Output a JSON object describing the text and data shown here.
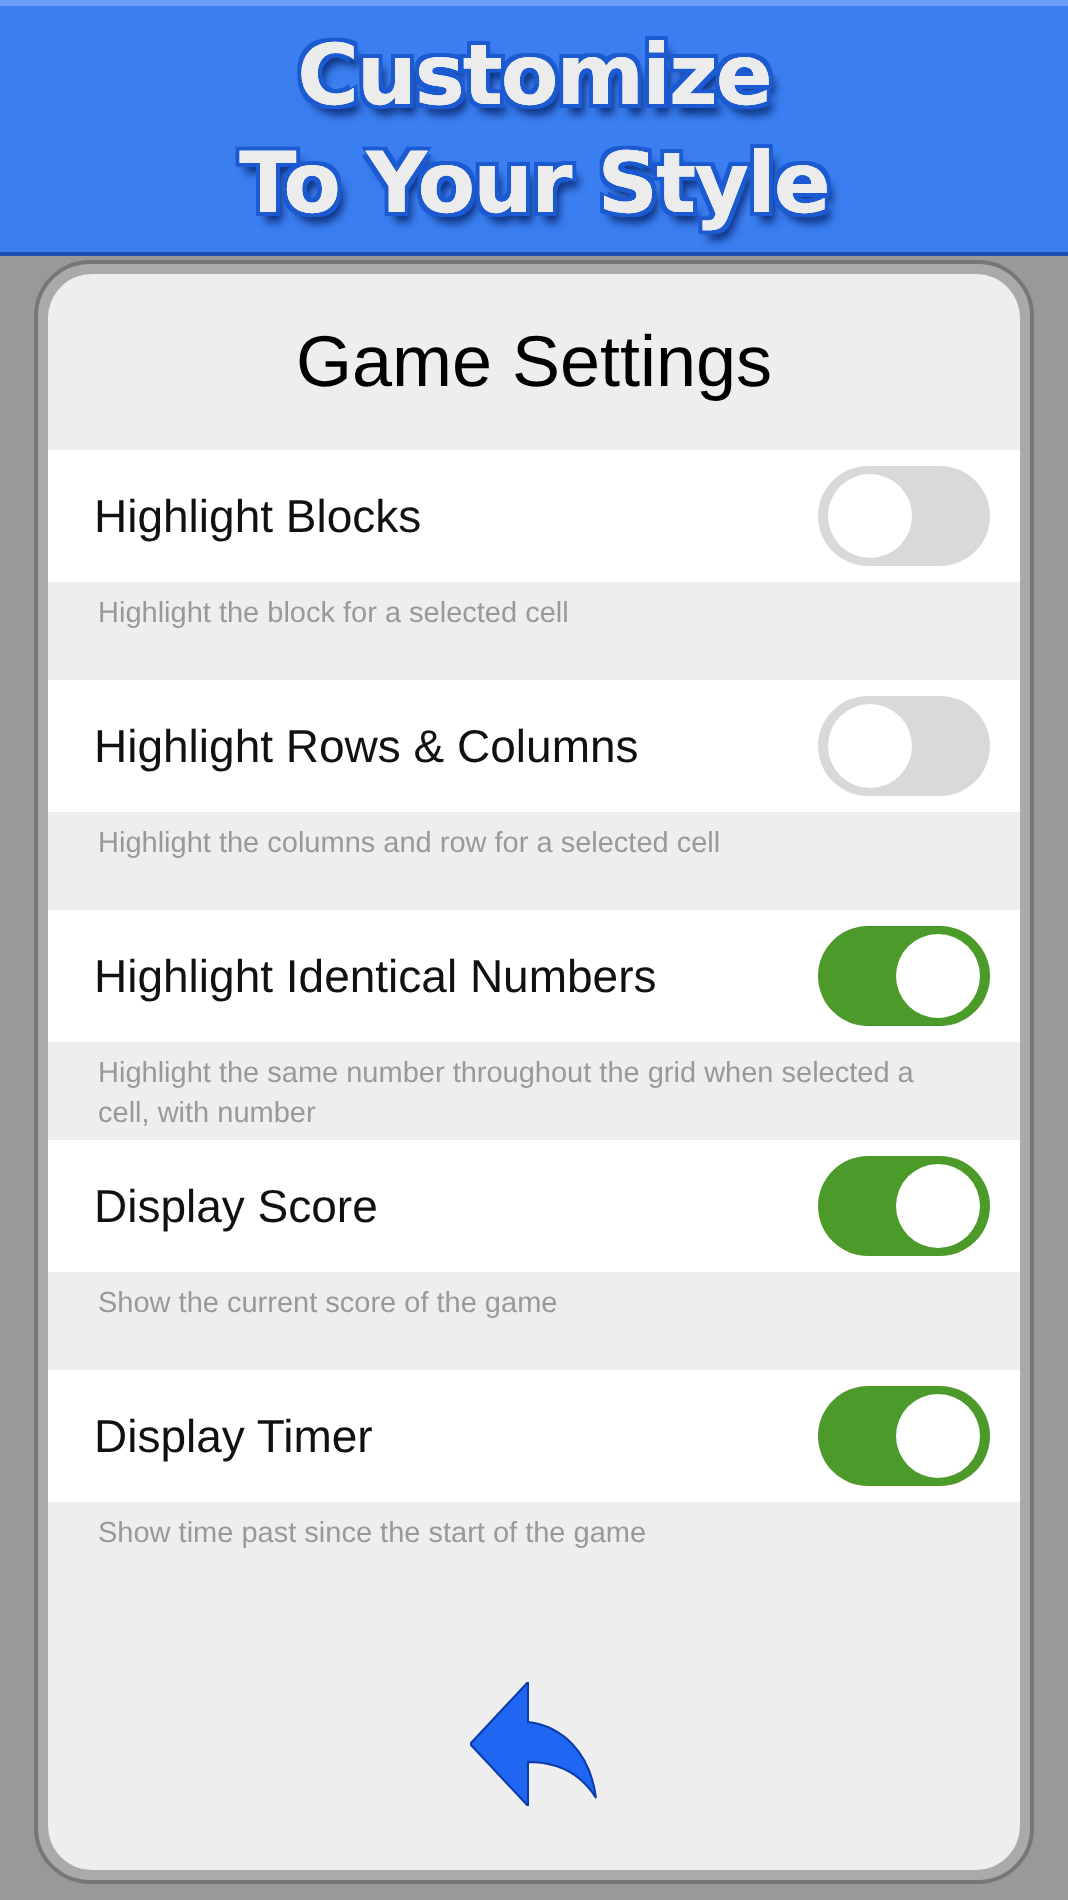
{
  "banner": {
    "lines": [
      "Customize",
      "To Your Style"
    ]
  },
  "dialog": {
    "title": "Game Settings"
  },
  "settings": [
    {
      "label": "Highlight Blocks",
      "on": false,
      "description": "Highlight the block for a selected cell"
    },
    {
      "label": "Highlight Rows & Columns",
      "on": false,
      "description": "Highlight the columns and row for a selected cell"
    },
    {
      "label": "Highlight Identical Numbers",
      "on": true,
      "description": "Highlight the same number throughout the grid when selected a cell, with number"
    },
    {
      "label": "Display Score",
      "on": true,
      "description": "Show the current score of the game"
    },
    {
      "label": "Display Timer",
      "on": true,
      "description": "Show time past since the start of the game"
    }
  ]
}
